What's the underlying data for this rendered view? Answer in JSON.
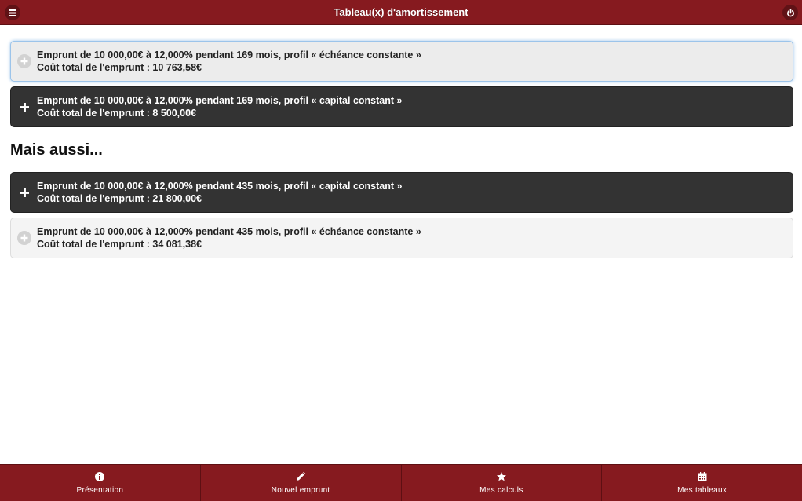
{
  "header": {
    "title": "Tableau(x) d'amortissement",
    "menu_icon": "hamburger-menu-icon",
    "power_icon": "power-icon"
  },
  "loans_primary": [
    {
      "line1": "Emprunt de 10 000,00€ à 12,000%  pendant 169 mois, profil « échéance constante »",
      "line2": "Coût total de l'emprunt : 10 763,58€",
      "style": "light",
      "icon": "plus-circle-icon"
    },
    {
      "line1": "Emprunt de 10 000,00€ à 12,000%  pendant 169 mois, profil « capital constant »",
      "line2": "Coût total de l'emprunt : 8 500,00€",
      "style": "dark",
      "icon": "plus-icon"
    }
  ],
  "section_title": "Mais aussi...",
  "loans_secondary": [
    {
      "line1": "Emprunt de 10 000,00€ à 12,000%  pendant 435 mois, profil « capital constant »",
      "line2": "Coût total de l'emprunt : 21 800,00€",
      "style": "dark",
      "icon": "plus-icon"
    },
    {
      "line1": "Emprunt de 10 000,00€ à 12,000%  pendant 435 mois, profil « échéance constante »",
      "line2": "Coût total de l'emprunt : 34 081,38€",
      "style": "light",
      "icon": "plus-circle-icon"
    }
  ],
  "footer": {
    "tabs": [
      {
        "label": "Présentation",
        "icon": "info-icon"
      },
      {
        "label": "Nouvel emprunt",
        "icon": "pencil-icon"
      },
      {
        "label": "Mes calculs",
        "icon": "star-icon"
      },
      {
        "label": "Mes tableaux",
        "icon": "calendar-icon"
      }
    ]
  },
  "colors": {
    "brand": "#861a1f",
    "dark_item": "#333333",
    "light_item": "#f4f4f4"
  }
}
